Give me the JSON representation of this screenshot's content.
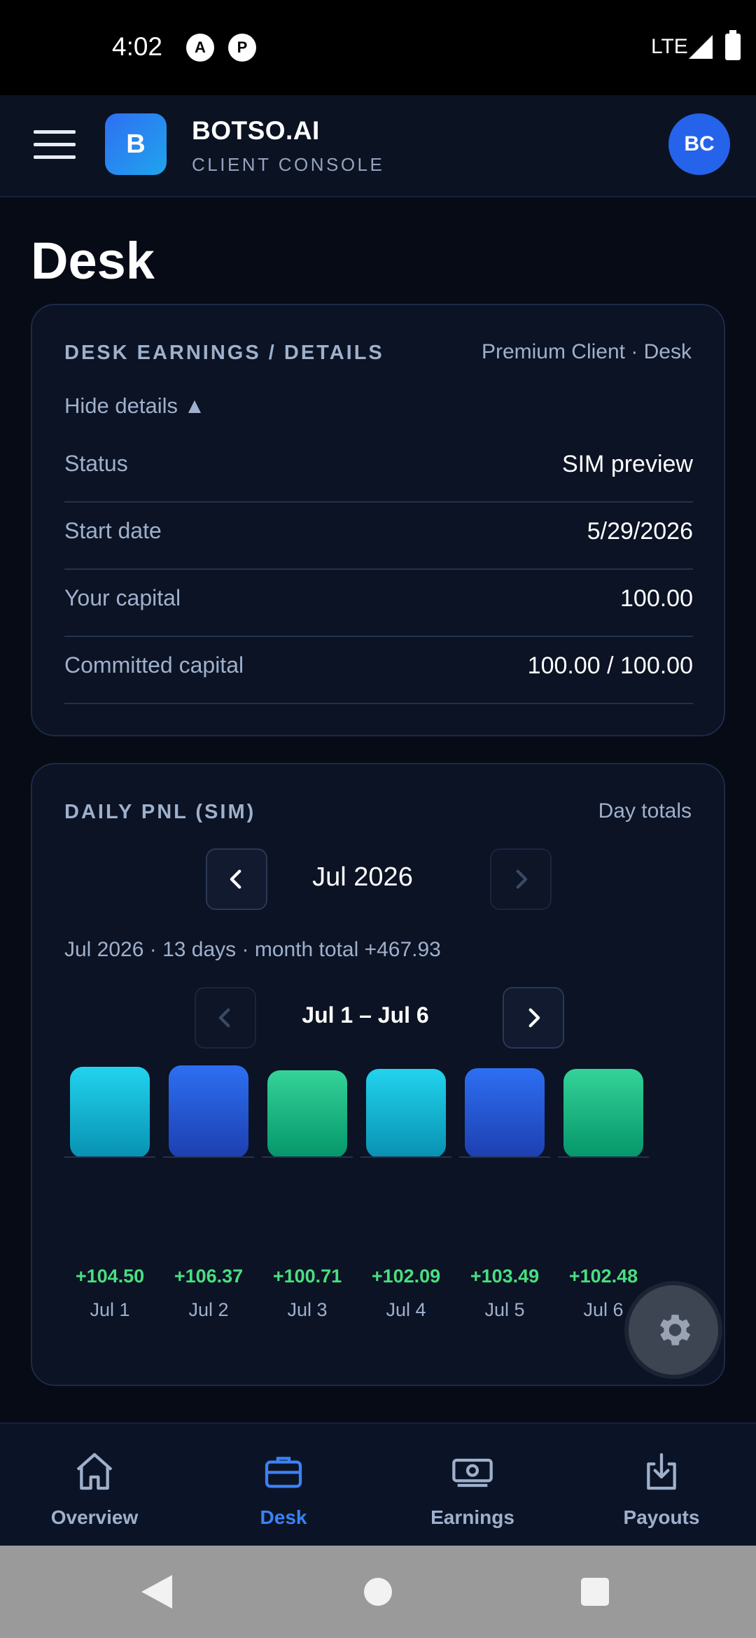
{
  "status_bar": {
    "time": "4:02",
    "network": "LTE",
    "app_icons": [
      "A",
      "P"
    ]
  },
  "header": {
    "logo_letter": "B",
    "brand": "BOTSO.AI",
    "subtitle": "CLIENT CONSOLE",
    "avatar": "BC"
  },
  "page": {
    "title": "Desk"
  },
  "details_card": {
    "label": "DESK EARNINGS / DETAILS",
    "meta": "Premium Client · Desk",
    "toggle": "Hide details ▲",
    "rows": [
      {
        "key": "Status",
        "value": "SIM preview"
      },
      {
        "key": "Start date",
        "value": "5/29/2026"
      },
      {
        "key": "Your capital",
        "value": "100.00"
      },
      {
        "key": "Committed capital",
        "value": "100.00 / 100.00"
      }
    ]
  },
  "pnl_card": {
    "label": "DAILY PNL (SIM)",
    "meta": "Day totals",
    "month": "Jul 2026",
    "summary": "Jul 2026 · 13 days · month total +467.93",
    "range": "Jul 1 – Jul 6",
    "days": [
      {
        "day": "Jul 1",
        "pnl": "+104.50",
        "color": "cyan"
      },
      {
        "day": "Jul 2",
        "pnl": "+106.37",
        "color": "blue"
      },
      {
        "day": "Jul 3",
        "pnl": "+100.71",
        "color": "green"
      },
      {
        "day": "Jul 4",
        "pnl": "+102.09",
        "color": "cyan"
      },
      {
        "day": "Jul 5",
        "pnl": "+103.49",
        "color": "blue"
      },
      {
        "day": "Jul 6",
        "pnl": "+102.48",
        "color": "green"
      }
    ]
  },
  "chart_data": {
    "type": "bar",
    "categories": [
      "Jul 1",
      "Jul 2",
      "Jul 3",
      "Jul 4",
      "Jul 5",
      "Jul 6"
    ],
    "values": [
      104.5,
      106.37,
      100.71,
      102.09,
      103.49,
      102.48
    ],
    "title": "DAILY PNL (SIM)",
    "xlabel": "",
    "ylabel": ""
  },
  "bottom_nav": [
    {
      "label": "Overview",
      "icon": "home-icon",
      "active": false
    },
    {
      "label": "Desk",
      "icon": "briefcase-icon",
      "active": true
    },
    {
      "label": "Earnings",
      "icon": "banknote-icon",
      "active": false
    },
    {
      "label": "Payouts",
      "icon": "download-tray-icon",
      "active": false
    }
  ],
  "colors": {
    "accent": "#3b82f6",
    "positive": "#4ade80",
    "background": "#060b16",
    "card": "#0b1324"
  }
}
